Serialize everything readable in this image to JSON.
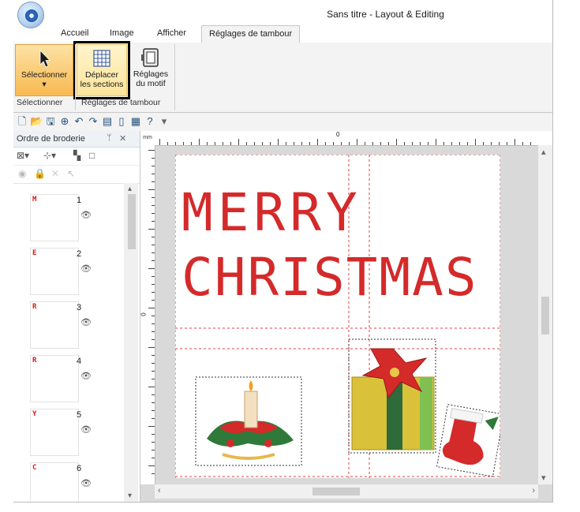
{
  "window": {
    "title": "Sans titre - Layout & Editing"
  },
  "tabs": [
    {
      "label": "Accueil"
    },
    {
      "label": "Image"
    },
    {
      "label": "Afficher"
    },
    {
      "label": "Réglages de tambour"
    }
  ],
  "ribbon": {
    "select_label_1": "Sélectionner",
    "select_arrow": "▾",
    "move_label_1": "Déplacer",
    "move_label_2": "les sections",
    "cfg_label_1": "Réglages",
    "cfg_label_2": "du motif",
    "group_select": "Sélectionner",
    "group_hoop": "Réglages de tambour"
  },
  "toolbar_icons": [
    "new-icon",
    "open-icon",
    "save-icon",
    "zoom-icon",
    "undo-icon",
    "redo-icon",
    "view-icon",
    "hoop-icon",
    "layers-icon",
    "help-icon",
    "dropdown-icon"
  ],
  "left_pane": {
    "title": "Ordre de broderie",
    "pin": "ᛘ",
    "close": "✕",
    "items": [
      {
        "letter": "M",
        "number": "1"
      },
      {
        "letter": "E",
        "number": "2"
      },
      {
        "letter": "R",
        "number": "3"
      },
      {
        "letter": "R",
        "number": "4"
      },
      {
        "letter": "Y",
        "number": "5"
      },
      {
        "letter": "C",
        "number": "6"
      }
    ]
  },
  "canvas": {
    "ruler_unit": "mm",
    "ruler_zero": "0",
    "line1": "MERRY",
    "line2": "CHRISTMAS",
    "text_color": "#d42a2a"
  },
  "colors": {
    "accent": "#f8b950",
    "selected_border": "#000000",
    "stitch_red": "#d42a2a",
    "guide_red": "#e04040"
  }
}
